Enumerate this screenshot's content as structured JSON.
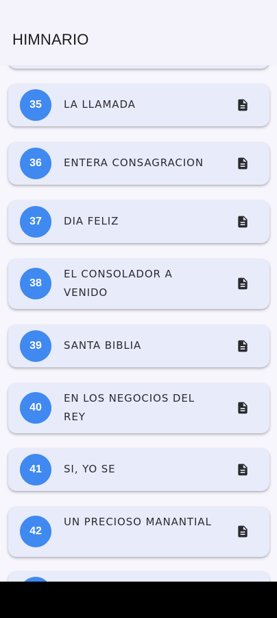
{
  "app": {
    "title": "HIMNARIO"
  },
  "hymns": [
    {
      "number": "35",
      "title": "LA LLAMADA"
    },
    {
      "number": "36",
      "title": "ENTERA CONSAGRACION"
    },
    {
      "number": "37",
      "title": "DIA FELIZ"
    },
    {
      "number": "38",
      "title": "EL CONSOLADOR A VENIDO"
    },
    {
      "number": "39",
      "title": "SANTA BIBLIA"
    },
    {
      "number": "40",
      "title": "EN LOS NEGOCIOS DEL REY"
    },
    {
      "number": "41",
      "title": "SI, YO SE"
    },
    {
      "number": "42",
      "title": "UN PRECIOSO MANANTIAL"
    }
  ],
  "icons": {
    "item_action": "document-icon"
  },
  "colors": {
    "badge": "#3f89f0",
    "card": "#e8ebfa",
    "background": "#f7f6fd"
  }
}
